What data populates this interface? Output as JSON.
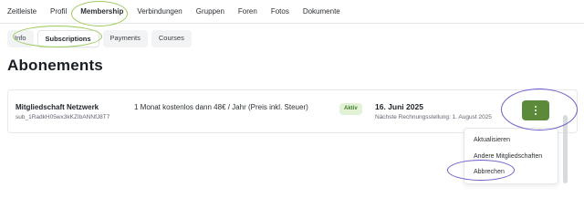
{
  "primary_nav": {
    "items": [
      {
        "label": "Zeitleiste"
      },
      {
        "label": "Profil"
      },
      {
        "label": "Membership"
      },
      {
        "label": "Verbindungen"
      },
      {
        "label": "Gruppen"
      },
      {
        "label": "Foren"
      },
      {
        "label": "Fotos"
      },
      {
        "label": "Dokumente"
      }
    ],
    "active": "Membership"
  },
  "secondary_nav": {
    "tabs": [
      {
        "label": "Info"
      },
      {
        "label": "Subscriptions"
      },
      {
        "label": "Payments"
      },
      {
        "label": "Courses"
      }
    ],
    "active": "Subscriptions"
  },
  "page": {
    "title": "Abonements"
  },
  "subscription": {
    "name": "Mitgliedschaft Netzwerk",
    "id": "sub_1RadkH05wx3kKZIbANNfJ8T7",
    "price": "1 Monat kostenlos dann 48€ / Jahr (Preis inkl. Steuer)",
    "status": "Aktiv",
    "date": "16. Juni 2025",
    "next_billing": "Nächste Rechnungsstellung: 1. August 2025"
  },
  "actions_menu": {
    "button_icon": "more-vertical-icon",
    "items": [
      {
        "label": "Aktualisieren"
      },
      {
        "label": "Andere Mitgliedschaften"
      },
      {
        "label": "Abbrechen"
      }
    ]
  },
  "colors": {
    "accent_green": "#5c8a3a",
    "status_bg": "#e1f2d7",
    "highlight_green": "#9cc95a",
    "highlight_purple": "#6a5fc8"
  }
}
